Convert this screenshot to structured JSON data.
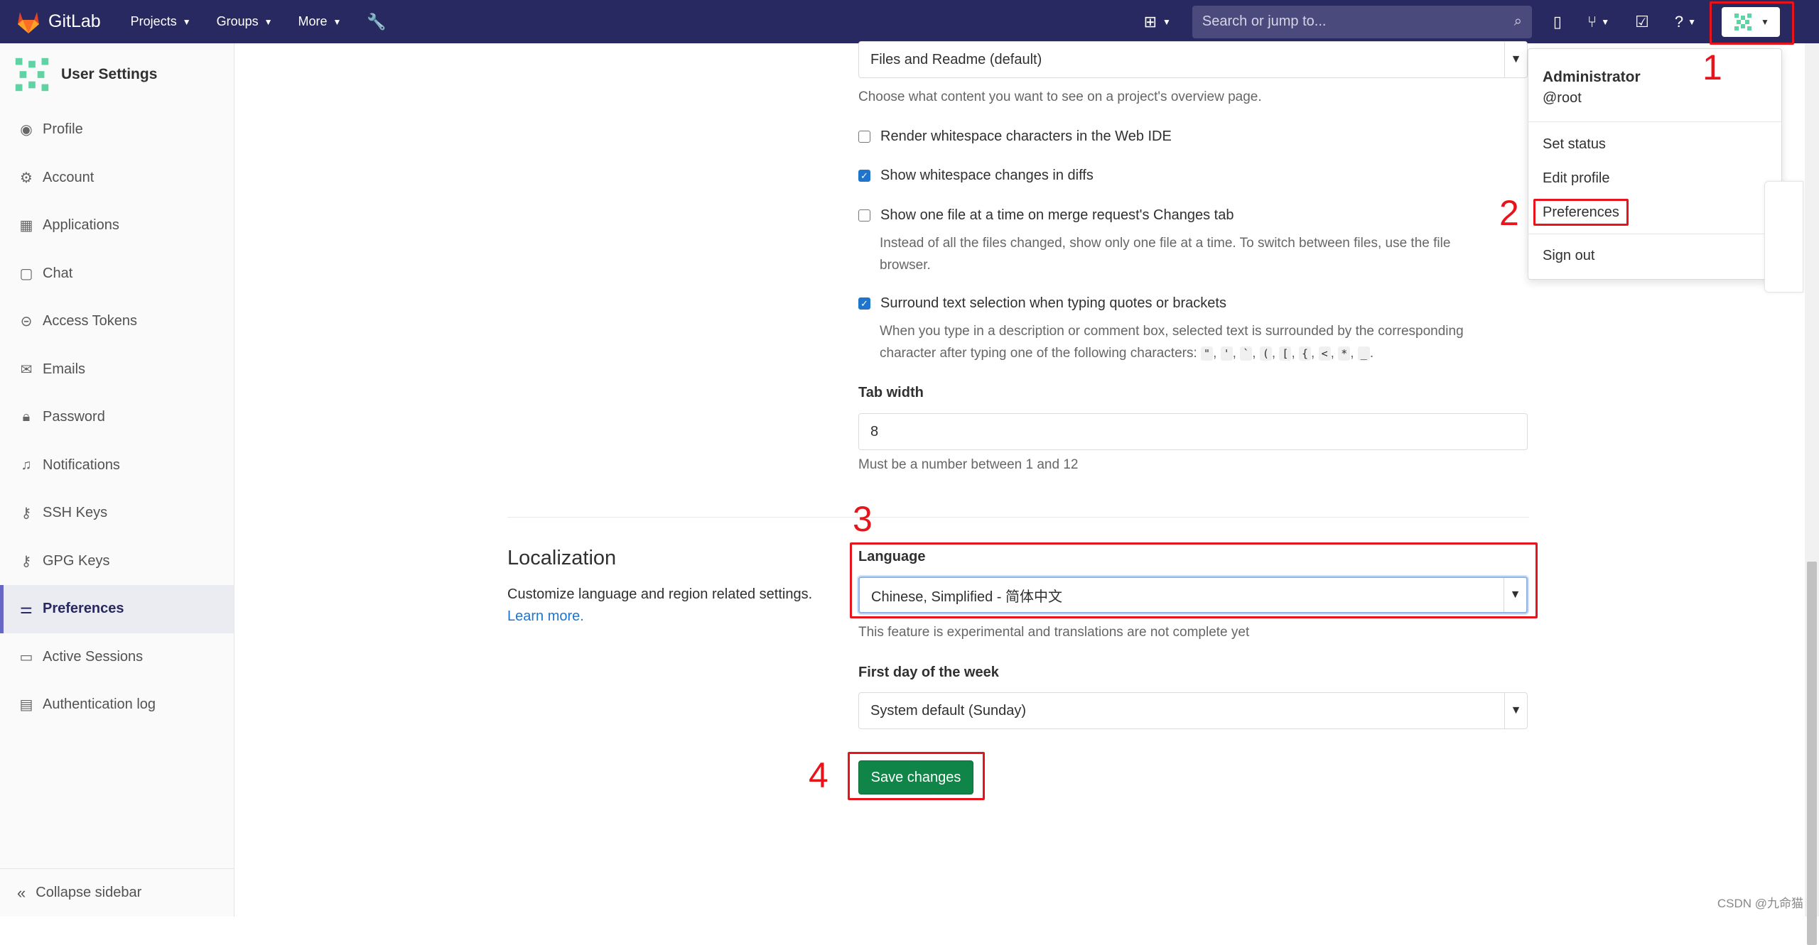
{
  "navbar": {
    "brand": "GitLab",
    "projects": "Projects",
    "groups": "Groups",
    "more": "More",
    "search_placeholder": "Search or jump to..."
  },
  "sidebar": {
    "title": "User Settings",
    "items": [
      {
        "label": "Profile",
        "icon": "profile-icon"
      },
      {
        "label": "Account",
        "icon": "account-icon"
      },
      {
        "label": "Applications",
        "icon": "applications-icon"
      },
      {
        "label": "Chat",
        "icon": "chat-icon"
      },
      {
        "label": "Access Tokens",
        "icon": "token-icon"
      },
      {
        "label": "Emails",
        "icon": "mail-icon"
      },
      {
        "label": "Password",
        "icon": "lock-icon"
      },
      {
        "label": "Notifications",
        "icon": "bell-icon"
      },
      {
        "label": "SSH Keys",
        "icon": "key-icon"
      },
      {
        "label": "GPG Keys",
        "icon": "key-icon"
      },
      {
        "label": "Preferences",
        "icon": "preferences-icon",
        "active": true
      },
      {
        "label": "Active Sessions",
        "icon": "monitor-icon"
      },
      {
        "label": "Authentication log",
        "icon": "log-icon"
      }
    ],
    "collapse": "Collapse sidebar"
  },
  "main": {
    "overview_select": "Files and Readme (default)",
    "overview_help": "Choose what content you want to see on a project's overview page.",
    "whitespace_ide": "Render whitespace characters in the Web IDE",
    "whitespace_diffs": "Show whitespace changes in diffs",
    "one_file": "Show one file at a time on merge request's Changes tab",
    "one_file_help_1": "Instead of all the files changed, show only one file at a time. To switch between files, use the file",
    "one_file_help_2": "browser.",
    "surround": "Surround text selection when typing quotes or brackets",
    "surround_help_1": "When you type in a description or comment box, selected text is surrounded by the corresponding",
    "surround_help_2": "character after typing one of the following characters:",
    "surround_chars": [
      "\"",
      "'",
      "`",
      "(",
      "[",
      "{",
      "<",
      "*",
      "_"
    ],
    "tab_width_label": "Tab width",
    "tab_width_value": "8",
    "tab_width_help": "Must be a number between 1 and 12",
    "localization_title": "Localization",
    "localization_desc": "Customize language and region related settings.",
    "learn_more": "Learn more.",
    "language_label": "Language",
    "language_value": "Chinese, Simplified - 简体中文",
    "language_help": "This feature is experimental and translations are not complete yet",
    "first_day_label": "First day of the week",
    "first_day_value": "System default (Sunday)",
    "save": "Save changes"
  },
  "dropdown": {
    "name": "Administrator",
    "username": "@root",
    "set_status": "Set status",
    "edit_profile": "Edit profile",
    "preferences": "Preferences",
    "sign_out": "Sign out"
  },
  "annotations": [
    "1",
    "2",
    "3",
    "4"
  ],
  "watermark": "CSDN @九命猫",
  "colors": {
    "navbar": "#292961",
    "annotation": "#e8141b",
    "save_button": "#108548",
    "link": "#1f75cb"
  }
}
